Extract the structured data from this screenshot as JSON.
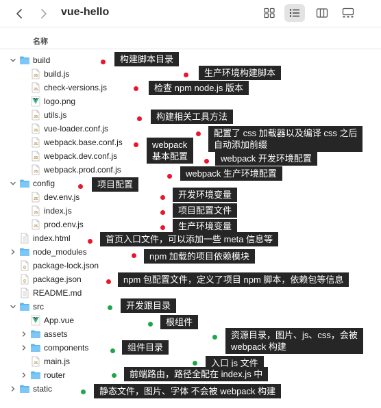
{
  "window": {
    "title": "vue-hello",
    "column_header": "名称"
  },
  "icons": {
    "back": "chevron-left-icon",
    "forward": "chevron-right-icon",
    "views": [
      "grid-view-icon",
      "list-view-icon",
      "column-view-icon",
      "gallery-view-icon"
    ],
    "active_view": "list-view-icon"
  },
  "colors": {
    "folder": "#5bb4ee",
    "annotation_bg": "#262626",
    "dot_red": "#e8172b",
    "dot_green": "#1ea64a"
  },
  "files": [
    {
      "name": "build",
      "type": "folder",
      "expanded": true
    },
    {
      "name": "build.js",
      "type": "js"
    },
    {
      "name": "check-versions.js",
      "type": "js"
    },
    {
      "name": "logo.png",
      "type": "vue-logo"
    },
    {
      "name": "utils.js",
      "type": "js"
    },
    {
      "name": "vue-loader.conf.js",
      "type": "js"
    },
    {
      "name": "webpack.base.conf.js",
      "type": "js"
    },
    {
      "name": "webpack.dev.conf.js",
      "type": "js"
    },
    {
      "name": "webpack.prod.conf.js",
      "type": "js"
    },
    {
      "name": "config",
      "type": "folder",
      "expanded": true
    },
    {
      "name": "dev.env.js",
      "type": "js"
    },
    {
      "name": "index.js",
      "type": "js"
    },
    {
      "name": "prod.env.js",
      "type": "js"
    },
    {
      "name": "index.html",
      "type": "html"
    },
    {
      "name": "node_modules",
      "type": "folder",
      "expanded": false
    },
    {
      "name": "package-lock.json",
      "type": "json"
    },
    {
      "name": "package.json",
      "type": "json"
    },
    {
      "name": "README.md",
      "type": "doc"
    },
    {
      "name": "src",
      "type": "folder",
      "expanded": true
    },
    {
      "name": "App.vue",
      "type": "vue"
    },
    {
      "name": "assets",
      "type": "folder",
      "expanded": false
    },
    {
      "name": "components",
      "type": "folder",
      "expanded": false
    },
    {
      "name": "main.js",
      "type": "js"
    },
    {
      "name": "router",
      "type": "folder",
      "expanded": false
    },
    {
      "name": "static",
      "type": "folder",
      "expanded": false
    }
  ],
  "annotations": [
    {
      "dot": "red",
      "text": "构建脚本目录"
    },
    {
      "dot": "red",
      "text": "生产环境构建脚本"
    },
    {
      "dot": "red",
      "text": "检查 npm node.js 版本"
    },
    {
      "dot": "red",
      "text": "构建相关工具方法"
    },
    {
      "dot": "red",
      "text": "配置了 css 加载器以及编译 css 之后\n自动添加前缀"
    },
    {
      "dot": "red",
      "text": "webpack\n基本配置"
    },
    {
      "dot": "red",
      "text": "webpack 开发环境配置"
    },
    {
      "dot": "red",
      "text": "webpack 生产环境配置"
    },
    {
      "dot": "red",
      "text": "项目配置"
    },
    {
      "dot": "red",
      "text": "开发环境变量"
    },
    {
      "dot": "red",
      "text": "项目配置文件"
    },
    {
      "dot": "red",
      "text": "生产环境变量"
    },
    {
      "dot": "red",
      "text": "首页入口文件，可以添加一些 meta 信息等"
    },
    {
      "dot": "red",
      "text": "npm 加载的项目依赖模块"
    },
    {
      "dot": "red",
      "text": "npm 包配置文件，定义了项目 npm 脚本，依赖包等信息"
    },
    {
      "dot": "green",
      "text": "开发跟目录"
    },
    {
      "dot": "green",
      "text": "根组件"
    },
    {
      "dot": "green",
      "text": "资源目录，图片、js、css，会被\nwebpack 构建"
    },
    {
      "dot": "green",
      "text": "组件目录"
    },
    {
      "dot": "green",
      "text": "入口 js 文件"
    },
    {
      "dot": "green",
      "text": "前端路由，路径全配在 index.js 中"
    },
    {
      "dot": "green",
      "text": "静态文件，图片、字体 不会被 webpack 构建"
    }
  ]
}
